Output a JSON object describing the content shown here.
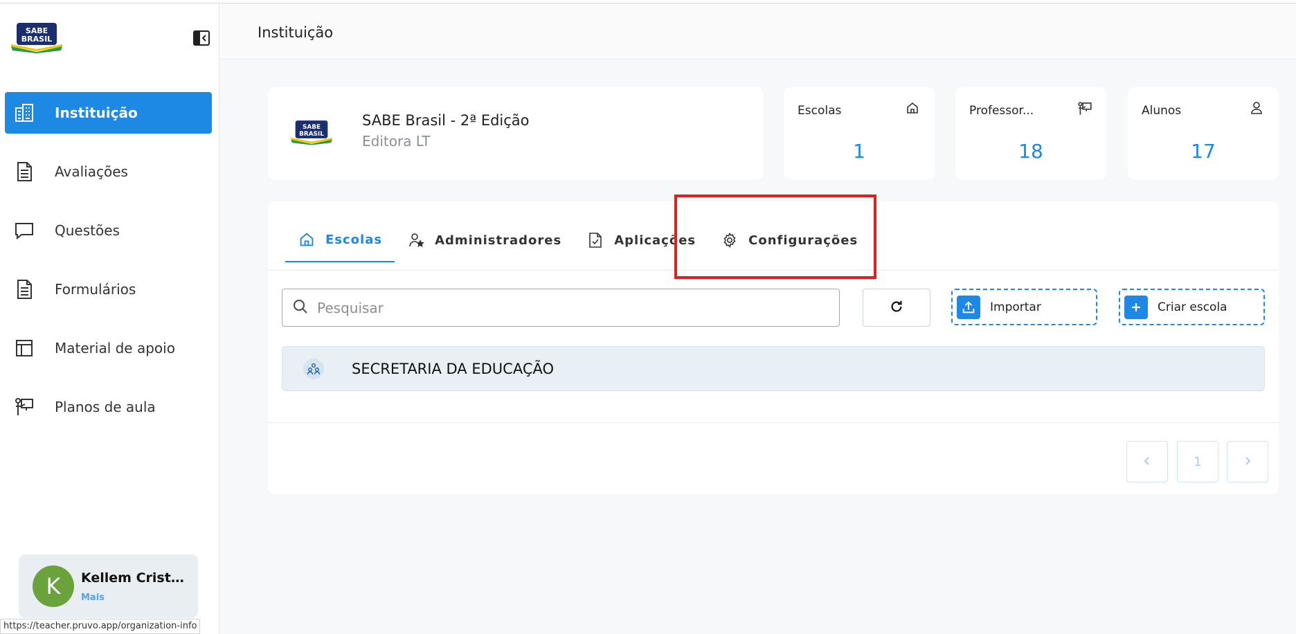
{
  "status_url": "https://teacher.pruvo.app/organization-info",
  "logo": {
    "line1": "SABE",
    "line2": "BRASIL"
  },
  "sidebar": {
    "items": [
      {
        "label": "Instituição",
        "icon": "building-icon",
        "active": true
      },
      {
        "label": "Avaliações",
        "icon": "document-icon"
      },
      {
        "label": "Questões",
        "icon": "chat-bubble-icon"
      },
      {
        "label": "Formulários",
        "icon": "form-icon"
      },
      {
        "label": "Material de apoio",
        "icon": "layout-icon"
      },
      {
        "label": "Planos de aula",
        "icon": "teacher-board-icon"
      }
    ]
  },
  "user": {
    "initial": "K",
    "name": "Kellem Cristi...",
    "more": "Mais",
    "avatar_color": "#6aa33b"
  },
  "header": {
    "title": "Instituição"
  },
  "organization": {
    "name": "SABE Brasil - 2ª Edição",
    "publisher": "Editora LT"
  },
  "stats": [
    {
      "label": "Escolas",
      "value": "1",
      "icon": "home-icon"
    },
    {
      "label": "Professor...",
      "value": "18",
      "icon": "teacher-board-icon"
    },
    {
      "label": "Alunos",
      "value": "17",
      "icon": "person-icon"
    }
  ],
  "tabs": [
    {
      "label": "Escolas",
      "icon": "home-icon",
      "active": true
    },
    {
      "label": "Administradores",
      "icon": "user-star-icon"
    },
    {
      "label": "Aplicações",
      "icon": "clipboard-check-icon"
    },
    {
      "label": "Configurações",
      "icon": "gear-icon"
    }
  ],
  "search": {
    "placeholder": "Pesquisar",
    "value": ""
  },
  "actions": {
    "import_label": "Importar",
    "create_label": "Criar escola"
  },
  "schools": [
    {
      "name": "SECRETARIA DA EDUCAÇÃO"
    }
  ],
  "pagination": {
    "current": "1"
  },
  "colors": {
    "accent": "#1e88e5",
    "highlight": "#e02020"
  }
}
